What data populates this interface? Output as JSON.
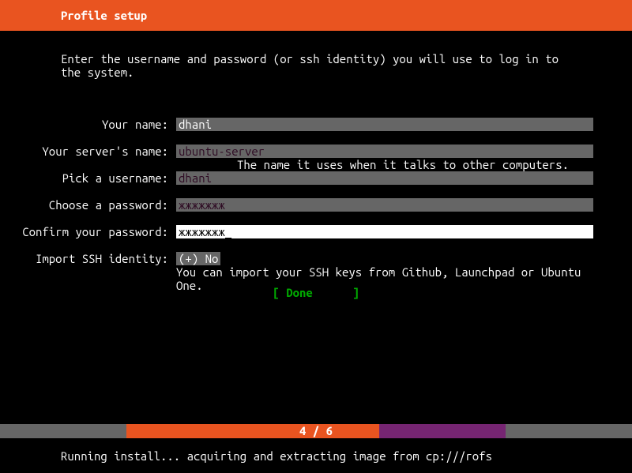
{
  "header": {
    "title": "Profile setup"
  },
  "instructions": "Enter the username and password (or ssh identity) you will use to log in to the system.",
  "form": {
    "your_name": {
      "label": "Your name:",
      "value": "dhani"
    },
    "server_name": {
      "label": "Your server's name:",
      "value": "ubuntu-server",
      "hint": "The name it uses when it talks to other computers."
    },
    "username": {
      "label": "Pick a username:",
      "value": "dhani"
    },
    "password": {
      "label": "Choose a password:",
      "value": "жжжжжжж"
    },
    "confirm": {
      "label": "Confirm your password:",
      "value": "жжжжжжж",
      "cursor": "_"
    },
    "ssh": {
      "label": "Import SSH identity:",
      "value": "(+) No",
      "hint": "You can import your SSH keys from Github, Launchpad or Ubuntu One."
    }
  },
  "done_button": "[ Done      ]",
  "progress": {
    "text": "4 / 6",
    "done_percent": 60,
    "partial_percent": 20
  },
  "status": "Running install... acquiring and extracting image from cp:///rofs"
}
